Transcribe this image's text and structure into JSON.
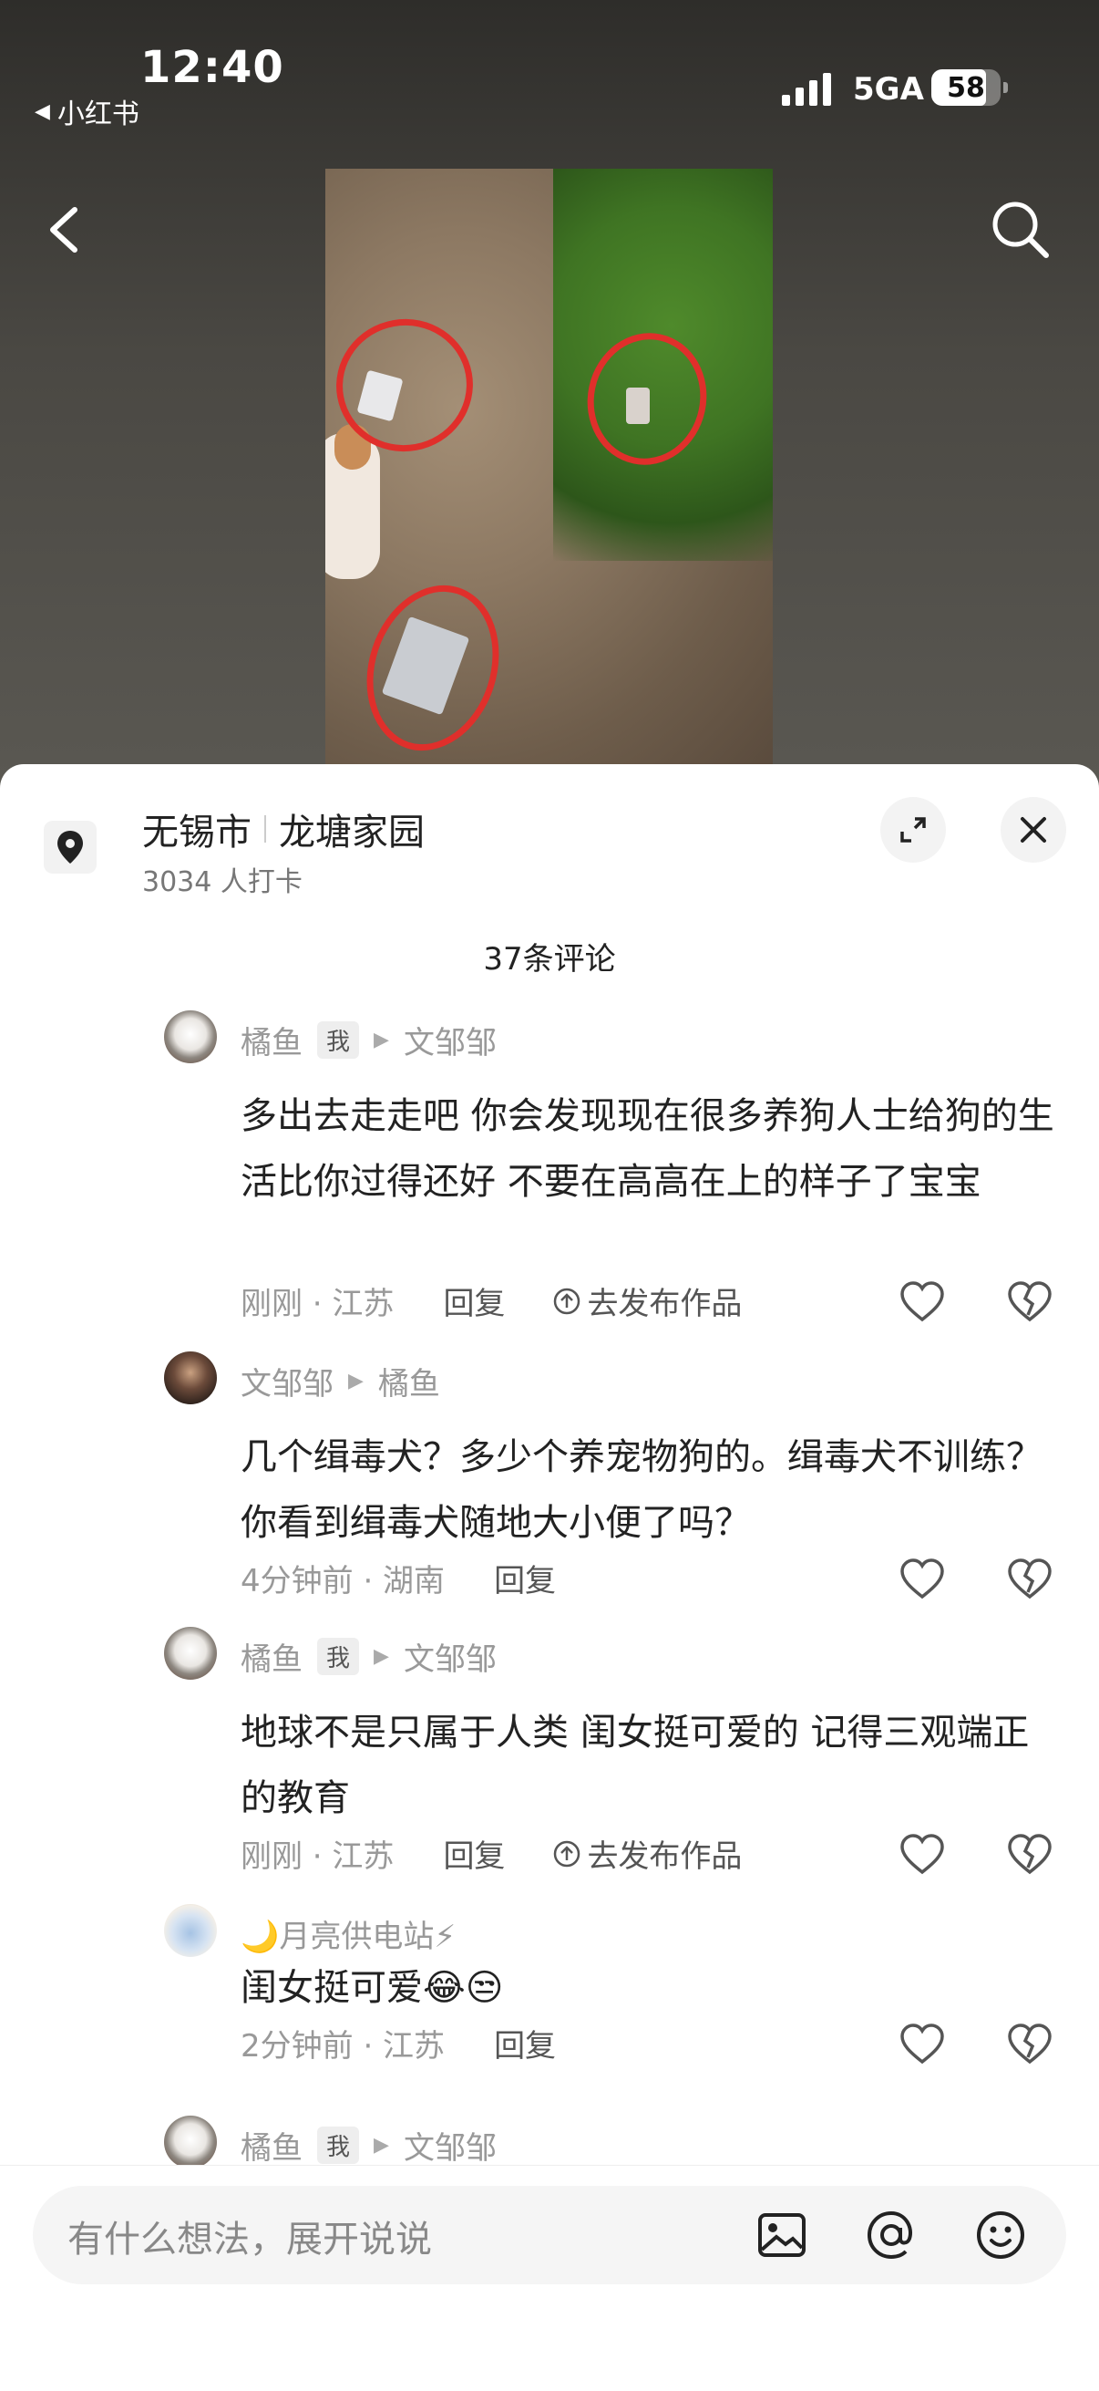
{
  "status_bar": {
    "time": "12:40",
    "back_app": "小红书",
    "network": "5GA",
    "battery": "58"
  },
  "location": {
    "city": "无锡市",
    "place": "龙塘家园",
    "checkins": "3034 人打卡"
  },
  "comments_count": "37条评论",
  "comments": [
    {
      "author": "橘鱼",
      "me_badge": "我",
      "reply_to": "文邹邹",
      "text": "多出去走走吧 你会发现现在很多养狗人士给狗的生活比你过得还好 不要在高高在上的样子了宝宝",
      "time_loc": "刚刚 · 江苏",
      "reply": "回复",
      "publish": "去发布作品"
    },
    {
      "author": "文邹邹",
      "reply_to": "橘鱼",
      "text": "几个缉毒犬？多少个养宠物狗的。缉毒犬不训练？你看到缉毒犬随地大小便了吗？",
      "time_loc": "4分钟前 · 湖南",
      "reply": "回复"
    },
    {
      "author": "橘鱼",
      "me_badge": "我",
      "reply_to": "文邹邹",
      "text": "地球不是只属于人类 闺女挺可爱的 记得三观端正的教育",
      "time_loc": "刚刚 · 江苏",
      "reply": "回复",
      "publish": "去发布作品"
    },
    {
      "author": "🌙月亮供电站⚡",
      "text": "闺女挺可爱😂😒",
      "time_loc": "2分钟前 · 江苏",
      "reply": "回复"
    },
    {
      "author": "橘鱼",
      "me_badge": "我",
      "reply_to": "文邹邹"
    }
  ],
  "input": {
    "placeholder": "有什么想法，展开说说"
  },
  "colors": {
    "annotation_red": "#e02f2b",
    "text_primary": "#222222",
    "text_secondary": "#999999"
  },
  "icons": [
    "back-icon",
    "search-icon",
    "location-pin-icon",
    "expand-icon",
    "close-icon",
    "heart-icon",
    "broken-heart-icon",
    "upload-icon",
    "image-icon",
    "at-icon",
    "emoji-icon"
  ]
}
